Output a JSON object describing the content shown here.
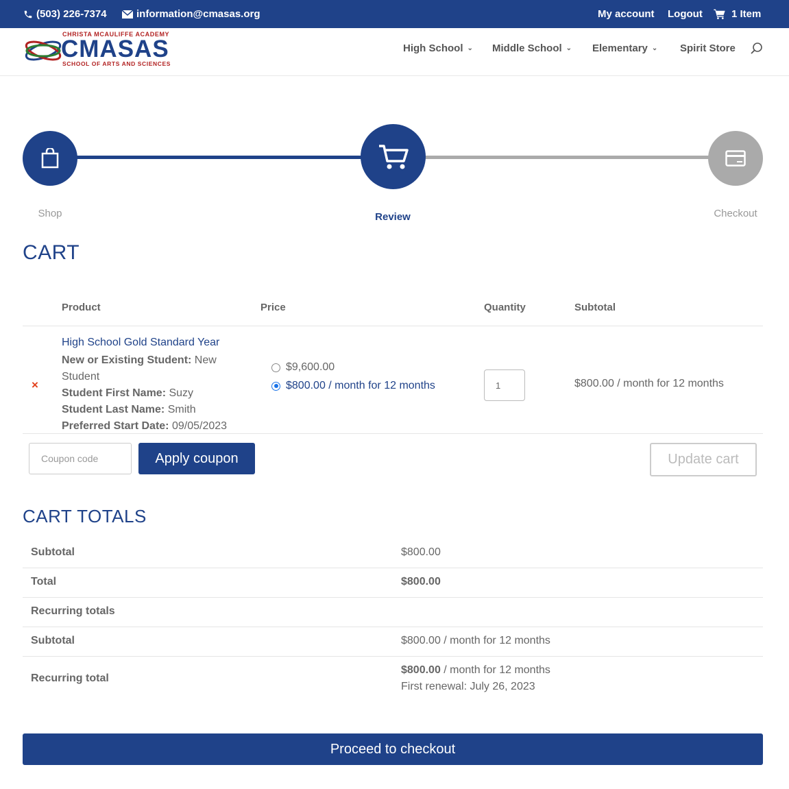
{
  "topbar": {
    "phone": "(503) 226-7374",
    "email": "information@cmasas.org",
    "my_account": "My account",
    "logout": "Logout",
    "cart_count": "1 Item"
  },
  "logo": {
    "top": "Christa McAuliffe Academy",
    "name": "CMASAS",
    "bottom": "School of Arts and Sciences"
  },
  "nav": {
    "high_school": "High School",
    "middle_school": "Middle School",
    "elementary": "Elementary",
    "spirit_store": "Spirit Store"
  },
  "steps": [
    {
      "label": "Shop",
      "state": "done"
    },
    {
      "label": "Review",
      "state": "active"
    },
    {
      "label": "Checkout",
      "state": "pending"
    }
  ],
  "cart": {
    "title": "CART",
    "headers": {
      "product": "Product",
      "price": "Price",
      "quantity": "Quantity",
      "subtotal": "Subtotal"
    },
    "item": {
      "remove": "×",
      "name": "High School Gold Standard Year",
      "meta": [
        {
          "label": "New or Existing Student:",
          "value": "New"
        },
        {
          "label": "",
          "value": "Student"
        },
        {
          "label": "Student First Name:",
          "value": "Suzy"
        },
        {
          "label": "Student Last Name:",
          "value": "Smith"
        },
        {
          "label": "Preferred Start Date:",
          "value": "09/05/2023"
        }
      ],
      "price_options": [
        {
          "label": "$9,600.00",
          "selected": false
        },
        {
          "label": "$800.00 / month for 12 months",
          "selected": true
        }
      ],
      "quantity": "1",
      "subtotal": "$800.00 / month for 12 months"
    },
    "coupon_placeholder": "Coupon code",
    "apply_coupon": "Apply coupon",
    "update_cart": "Update cart"
  },
  "totals": {
    "title": "CART TOTALS",
    "rows": [
      {
        "label": "Subtotal",
        "value": "$800.00"
      },
      {
        "label": "Total",
        "value": "$800.00"
      },
      {
        "label": "Recurring totals",
        "value": ""
      },
      {
        "label": "Subtotal",
        "value": "$800.00 / month for 12 months"
      },
      {
        "label": "Recurring total",
        "value_bold": "$800.00",
        "value_rest": " / month for 12 months",
        "renewal": "First renewal: July 26, 2023"
      }
    ]
  },
  "checkout_button": "Proceed to checkout",
  "colors": {
    "brand": "#1f4289",
    "inactive": "#aaaaaa",
    "remove": "#e2401c"
  }
}
